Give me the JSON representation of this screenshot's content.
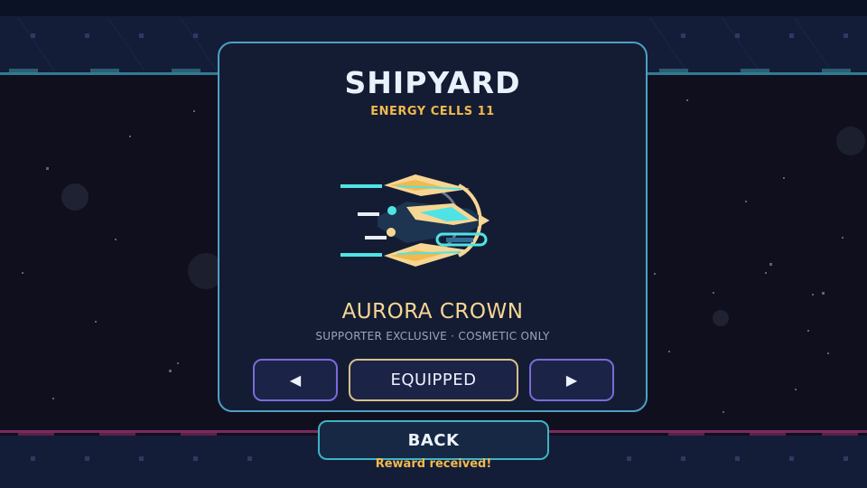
{
  "shipyard": {
    "title": "SHIPYARD",
    "energy_label": "ENERGY CELLS  11"
  },
  "ship": {
    "name": "AURORA CROWN",
    "description": "SUPPORTER EXCLUSIVE · COSMETIC ONLY"
  },
  "controls": {
    "prev_label": "◀",
    "equip_label": "EQUIPPED",
    "next_label": "▶",
    "back_label": "BACK"
  },
  "status": {
    "message": "Reward received!"
  },
  "colors": {
    "accent_cyan": "#4fe3e6",
    "accent_gold": "#f2b94c",
    "panel_border": "#4f9fc4",
    "nav_border": "#7a6bd8"
  }
}
